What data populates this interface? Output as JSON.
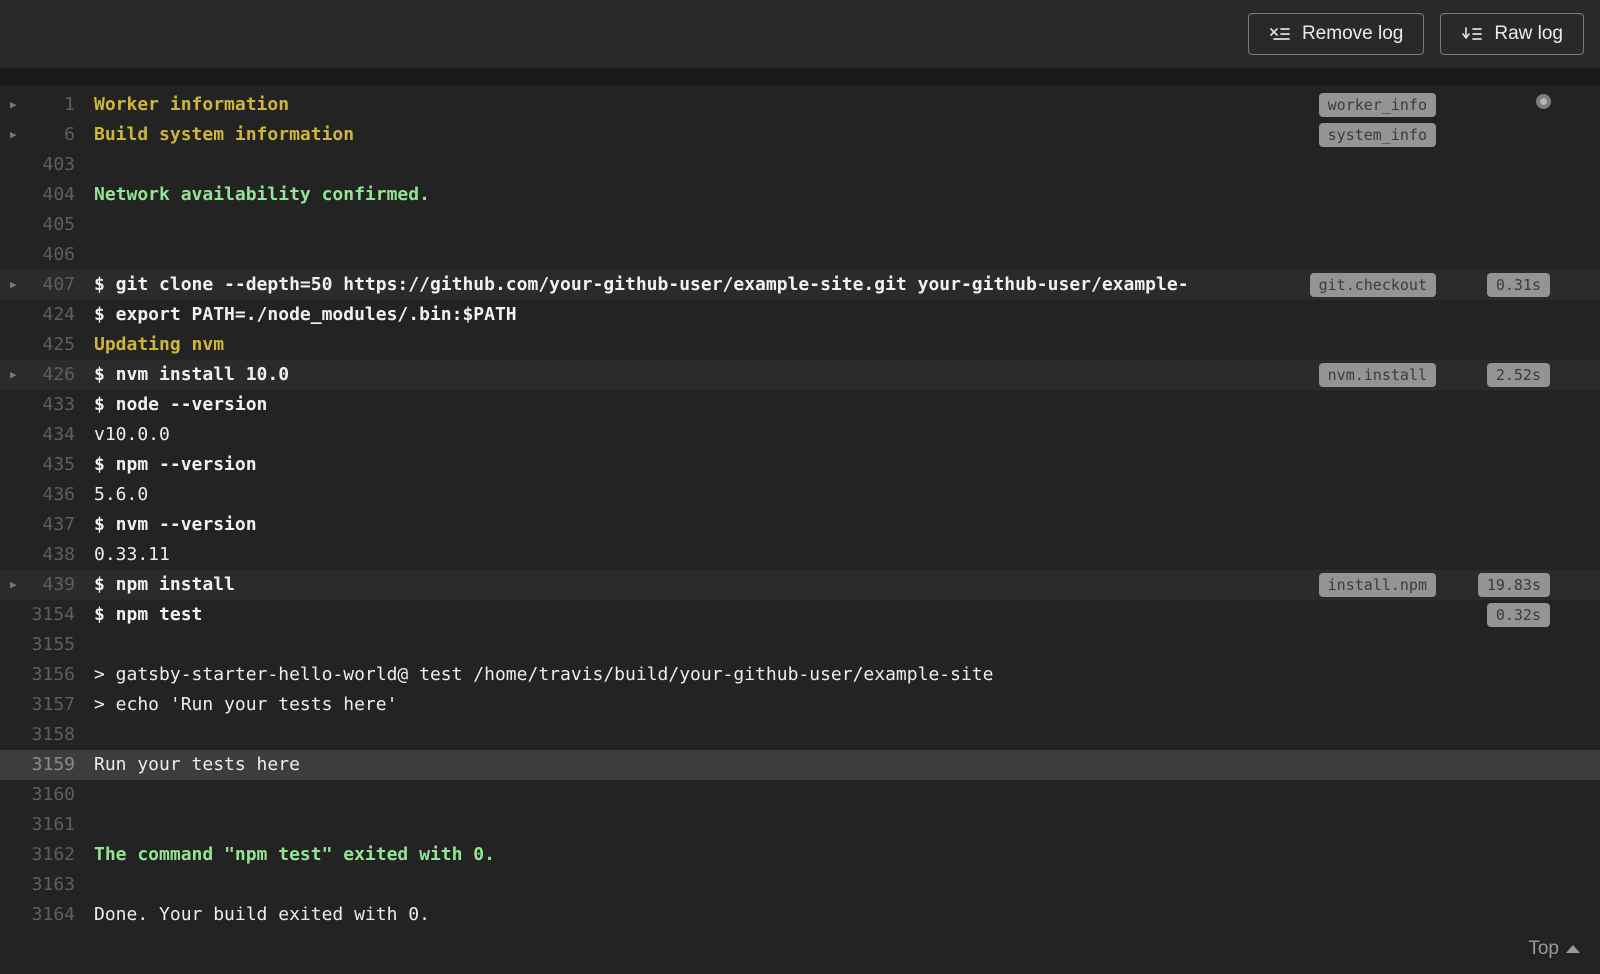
{
  "colors": {
    "page_background": "#1a1a1a",
    "topbar_background": "#29292b",
    "log_background": "#232323",
    "log_text": "#efefef",
    "log_yellow": "#cfb53b",
    "log_green": "#93e593",
    "line_number": "#5e5e5e",
    "badge_background": "#949494",
    "badge_text": "#3b3b3b",
    "highlight_row": "#2b2b2b",
    "highlight_strong": "#3d3d3d"
  },
  "toolbar": {
    "remove_log_label": "Remove log",
    "raw_log_label": "Raw log"
  },
  "footer": {
    "top_link_label": "Top"
  },
  "log": {
    "lines": [
      {
        "num": "1",
        "text": "Worker information",
        "style": "yellow",
        "arrow": true,
        "badge": "worker_info",
        "time": null,
        "highlight": false,
        "follow": true
      },
      {
        "num": "6",
        "text": "Build system information",
        "style": "yellow",
        "arrow": true,
        "badge": "system_info",
        "time": null,
        "highlight": false
      },
      {
        "num": "403",
        "text": "",
        "style": "output",
        "arrow": false,
        "badge": null,
        "time": null,
        "highlight": false
      },
      {
        "num": "404",
        "text": "Network availability confirmed.",
        "style": "green",
        "arrow": false,
        "badge": null,
        "time": null,
        "highlight": false
      },
      {
        "num": "405",
        "text": "",
        "style": "output",
        "arrow": false,
        "badge": null,
        "time": null,
        "highlight": false
      },
      {
        "num": "406",
        "text": "",
        "style": "output",
        "arrow": false,
        "badge": null,
        "time": null,
        "highlight": false
      },
      {
        "num": "407",
        "text": "$ git clone --depth=50 https://github.com/your-github-user/example-site.git your-github-user/example-",
        "style": "command",
        "arrow": true,
        "badge": "git.checkout",
        "time": "0.31s",
        "highlight": "row"
      },
      {
        "num": "424",
        "text": "$ export PATH=./node_modules/.bin:$PATH",
        "style": "command",
        "arrow": false,
        "badge": null,
        "time": null,
        "highlight": false
      },
      {
        "num": "425",
        "text": "Updating nvm",
        "style": "yellow",
        "arrow": false,
        "badge": null,
        "time": null,
        "highlight": false
      },
      {
        "num": "426",
        "text": "$ nvm install 10.0",
        "style": "command",
        "arrow": true,
        "badge": "nvm.install",
        "time": "2.52s",
        "highlight": "row"
      },
      {
        "num": "433",
        "text": "$ node --version",
        "style": "command",
        "arrow": false,
        "badge": null,
        "time": null,
        "highlight": false
      },
      {
        "num": "434",
        "text": "v10.0.0",
        "style": "output",
        "arrow": false,
        "badge": null,
        "time": null,
        "highlight": false
      },
      {
        "num": "435",
        "text": "$ npm --version",
        "style": "command",
        "arrow": false,
        "badge": null,
        "time": null,
        "highlight": false
      },
      {
        "num": "436",
        "text": "5.6.0",
        "style": "output",
        "arrow": false,
        "badge": null,
        "time": null,
        "highlight": false
      },
      {
        "num": "437",
        "text": "$ nvm --version",
        "style": "command",
        "arrow": false,
        "badge": null,
        "time": null,
        "highlight": false
      },
      {
        "num": "438",
        "text": "0.33.11",
        "style": "output",
        "arrow": false,
        "badge": null,
        "time": null,
        "highlight": false
      },
      {
        "num": "439",
        "text": "$ npm install",
        "style": "command",
        "arrow": true,
        "badge": "install.npm",
        "time": "19.83s",
        "highlight": "row"
      },
      {
        "num": "3154",
        "text": "$ npm test",
        "style": "command",
        "arrow": false,
        "badge": null,
        "time": "0.32s",
        "highlight": false
      },
      {
        "num": "3155",
        "text": "",
        "style": "output",
        "arrow": false,
        "badge": null,
        "time": null,
        "highlight": false
      },
      {
        "num": "3156",
        "text": "> gatsby-starter-hello-world@ test /home/travis/build/your-github-user/example-site",
        "style": "output",
        "arrow": false,
        "badge": null,
        "time": null,
        "highlight": false
      },
      {
        "num": "3157",
        "text": "> echo 'Run your tests here'",
        "style": "output",
        "arrow": false,
        "badge": null,
        "time": null,
        "highlight": false
      },
      {
        "num": "3158",
        "text": "",
        "style": "output",
        "arrow": false,
        "badge": null,
        "time": null,
        "highlight": false
      },
      {
        "num": "3159",
        "text": "Run your tests here",
        "style": "output",
        "arrow": false,
        "badge": null,
        "time": null,
        "highlight": "strong"
      },
      {
        "num": "3160",
        "text": "",
        "style": "output",
        "arrow": false,
        "badge": null,
        "time": null,
        "highlight": false
      },
      {
        "num": "3161",
        "text": "",
        "style": "output",
        "arrow": false,
        "badge": null,
        "time": null,
        "highlight": false
      },
      {
        "num": "3162",
        "text": "The command \"npm test\" exited with 0.",
        "style": "green",
        "arrow": false,
        "badge": null,
        "time": null,
        "highlight": false
      },
      {
        "num": "3163",
        "text": "",
        "style": "output",
        "arrow": false,
        "badge": null,
        "time": null,
        "highlight": false
      },
      {
        "num": "3164",
        "text": "Done. Your build exited with 0.",
        "style": "output",
        "arrow": false,
        "badge": null,
        "time": null,
        "highlight": false
      }
    ]
  }
}
